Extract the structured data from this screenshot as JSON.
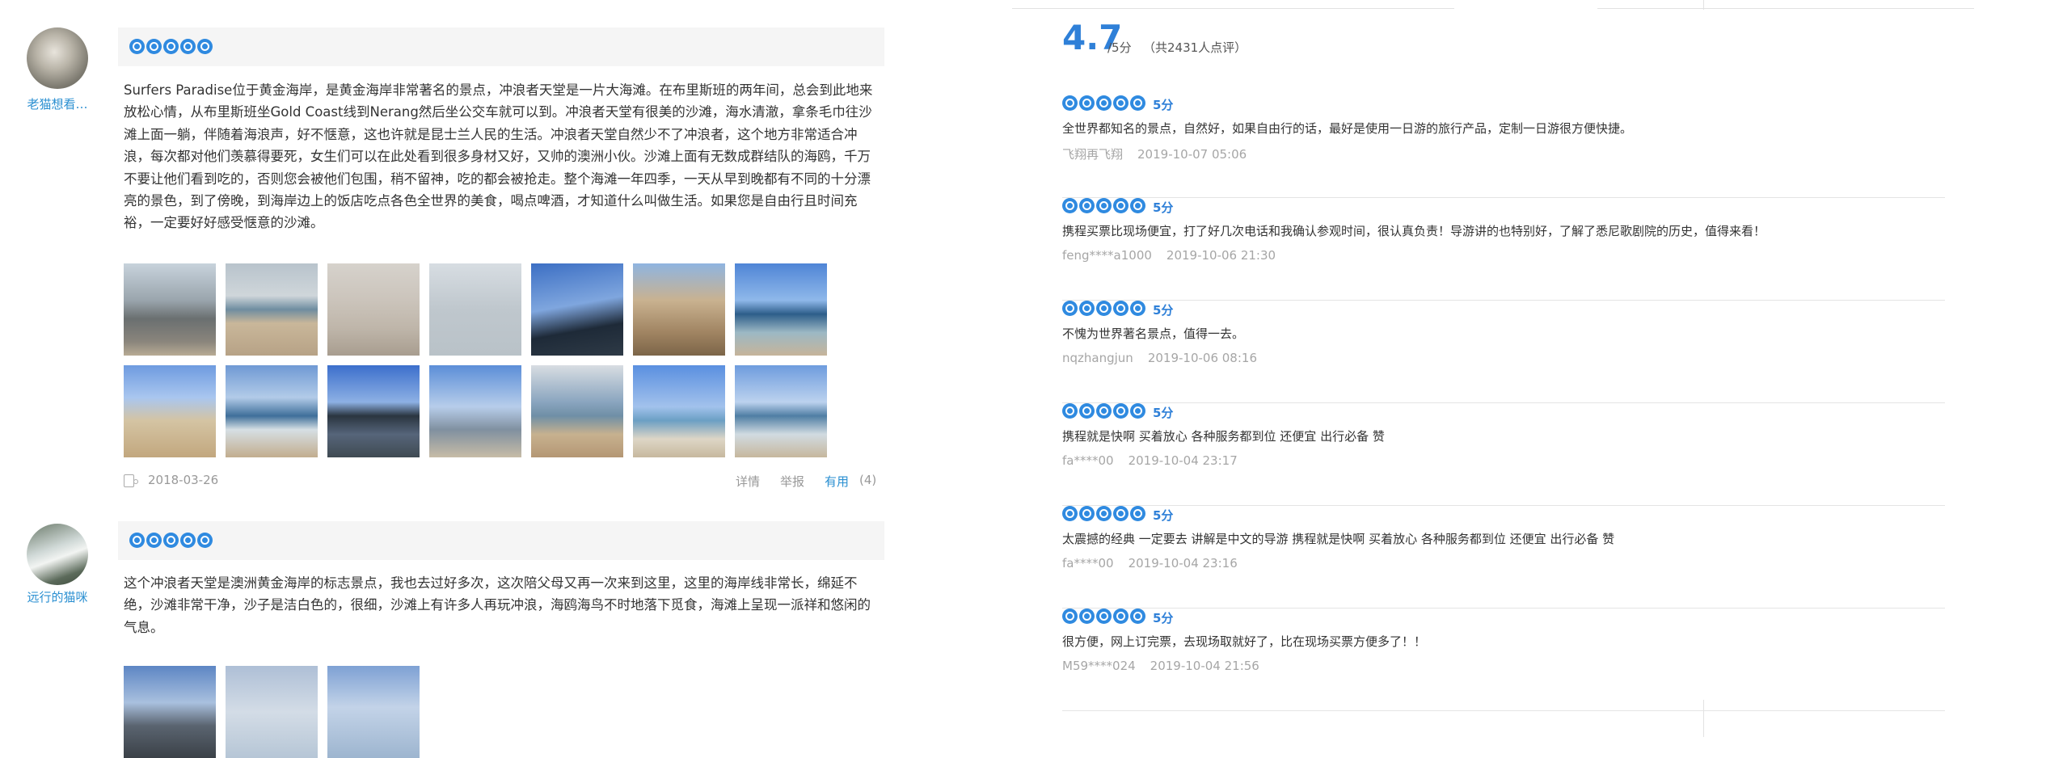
{
  "left_reviews": [
    {
      "user": "老猫想看…",
      "rating": 5,
      "text": "Surfers Paradise位于黄金海岸，是黄金海岸非常著名的景点，冲浪者天堂是一片大海滩。在布里斯班的两年间，总会到此地来放松心情，从布里斯班坐Gold Coast线到Nerang然后坐公交车就可以到。冲浪者天堂有很美的沙滩，海水清澈，拿条毛巾往沙滩上面一躺，伴随着海浪声，好不惬意，这也许就是昆士兰人民的生活。冲浪者天堂自然少不了冲浪者，这个地方非常适合冲浪，每次都对他们羡慕得要死，女生们可以在此处看到很多身材又好，又帅的澳洲小伙。沙滩上面有无数成群结队的海鸥，千万不要让他们看到吃的，否则您会被他们包围，稍不留神，吃的都会被抢走。整个海滩一年四季，一天从早到晚都有不同的十分漂亮的景色，到了傍晚，到海岸边上的饭店吃点各色全世界的美食，喝点啤酒，才知道什么叫做生活。如果您是自由行且时间充裕，一定要好好感受惬意的沙滩。",
      "photo_count": 14,
      "date": "2018-03-26",
      "actions": {
        "detail": "详情",
        "report": "举报",
        "useful": "有用",
        "useful_count": "(4)"
      }
    },
    {
      "user": "远行的猫咪",
      "rating": 5,
      "text": "这个冲浪者天堂是澳洲黄金海岸的标志景点，我也去过好多次，这次陪父母又再一次来到这里，这里的海岸线非常长，绵延不绝，沙滩非常干净，沙子是洁白色的，很细，沙滩上有许多人再玩冲浪，海鸥海鸟不时地落下觅食，海滩上呈现一派祥和悠闲的气息。",
      "photo_count": 3
    }
  ],
  "summary": {
    "score": "4.7",
    "unit": "/5分",
    "count_text": "（共2431人点评）"
  },
  "right_reviews": [
    {
      "rating": 5,
      "score_label": "5分",
      "text": "全世界都知名的景点，自然好，如果自由行的话，最好是使用一日游的旅行产品，定制一日游很方便快捷。",
      "user": "飞翔再飞翔",
      "time": "2019-10-07 05:06"
    },
    {
      "rating": 5,
      "score_label": "5分",
      "text": "携程买票比现场便宜，打了好几次电话和我确认参观时间，很认真负责！导游讲的也特别好，了解了悉尼歌剧院的历史，值得来看！",
      "user": "feng****a1000",
      "time": "2019-10-06 21:30"
    },
    {
      "rating": 5,
      "score_label": "5分",
      "text": "不愧为世界著名景点，值得一去。",
      "user": "nqzhangjun",
      "time": "2019-10-06 08:16"
    },
    {
      "rating": 5,
      "score_label": "5分",
      "text": "携程就是快啊 买着放心 各种服务都到位 还便宜 出行必备 赞",
      "user": "fa****00",
      "time": "2019-10-04 23:17"
    },
    {
      "rating": 5,
      "score_label": "5分",
      "text": "太震撼的经典 一定要去 讲解是中文的导游 携程就是快啊 买着放心 各种服务都到位 还便宜 出行必备 赞",
      "user": "fa****00",
      "time": "2019-10-04 23:16"
    },
    {
      "rating": 5,
      "score_label": "5分",
      "text": "很方便，网上订完票，去现场取就好了，比在现场买票方便多了！！",
      "user": "M59****024",
      "time": "2019-10-04 21:56"
    }
  ]
}
